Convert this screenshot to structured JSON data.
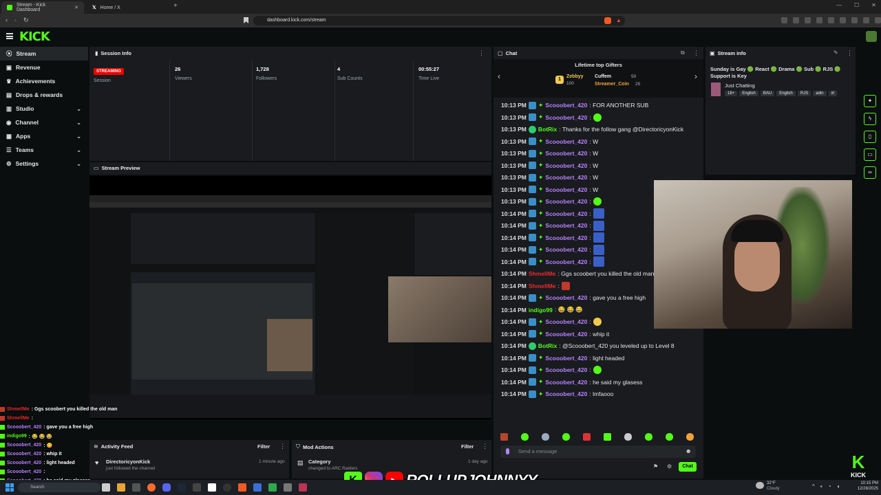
{
  "browser": {
    "tabs": [
      {
        "label": "Stream - Kick Dashboard",
        "active": true
      },
      {
        "label": "Home / X",
        "active": false
      }
    ],
    "url": "dashboard.kick.com/stream"
  },
  "logo": "KICK",
  "sidebar": {
    "items": [
      {
        "label": "Stream",
        "icon": "broadcast-icon",
        "active": true,
        "expandable": false
      },
      {
        "label": "Revenue",
        "icon": "wallet-icon",
        "expandable": false
      },
      {
        "label": "Achievements",
        "icon": "trophy-icon",
        "expandable": false
      },
      {
        "label": "Drops & rewards",
        "icon": "gift-icon",
        "expandable": false
      },
      {
        "label": "Studio",
        "icon": "studio-icon",
        "expandable": true
      },
      {
        "label": "Channel",
        "icon": "channel-icon",
        "expandable": true
      },
      {
        "label": "Apps",
        "icon": "apps-icon",
        "expandable": true
      },
      {
        "label": "Teams",
        "icon": "teams-icon",
        "expandable": true
      },
      {
        "label": "Settings",
        "icon": "gear-icon",
        "expandable": true
      }
    ]
  },
  "session": {
    "title": "Session Info",
    "badge": "STREAMING",
    "stats": [
      {
        "value": "",
        "label": "Session"
      },
      {
        "value": "26",
        "label": "Viewers"
      },
      {
        "value": "1,728",
        "label": "Followers"
      },
      {
        "value": "4",
        "label": "Sub Counts"
      },
      {
        "value": "00:55:27",
        "label": "Time Live"
      }
    ]
  },
  "preview": {
    "title": "Stream Preview"
  },
  "chat": {
    "title": "Chat",
    "gifters_title": "Lifetime top Gifters",
    "gifters": [
      {
        "name": "Zebbyy",
        "count": "100"
      },
      {
        "name": "Cuffem",
        "count": "50"
      },
      {
        "name": "Streamer_Coin",
        "count": "25"
      }
    ],
    "messages": [
      {
        "time": "10:13 PM",
        "user": "Scooobert_420",
        "text": ": FOR ANOTHER SUB",
        "color": "#b983ff"
      },
      {
        "time": "10:13 PM",
        "user": "Scooobert_420",
        "text": ":",
        "color": "#b983ff",
        "emote": "green"
      },
      {
        "time": "10:13 PM",
        "user": "BotRix",
        "text": ": Thanks for the follow gang @DirectoricyonKick",
        "color": "#53fc18"
      },
      {
        "time": "10:13 PM",
        "user": "Scooobert_420",
        "text": ": W",
        "color": "#b983ff"
      },
      {
        "time": "10:13 PM",
        "user": "Scooobert_420",
        "text": ": W",
        "color": "#b983ff"
      },
      {
        "time": "10:13 PM",
        "user": "Scooobert_420",
        "text": ": W",
        "color": "#b983ff"
      },
      {
        "time": "10:13 PM",
        "user": "Scooobert_420",
        "text": ": W",
        "color": "#b983ff"
      },
      {
        "time": "10:13 PM",
        "user": "Scooobert_420",
        "text": ": W",
        "color": "#b983ff"
      },
      {
        "time": "10:13 PM",
        "user": "Scooobert_420",
        "text": ":",
        "color": "#b983ff",
        "emote": "green"
      },
      {
        "time": "10:14 PM",
        "user": "Scooobert_420",
        "text": ":",
        "color": "#b983ff",
        "emote": "gang"
      },
      {
        "time": "10:14 PM",
        "user": "Scooobert_420",
        "text": ":",
        "color": "#b983ff",
        "emote": "gang"
      },
      {
        "time": "10:14 PM",
        "user": "Scooobert_420",
        "text": ":",
        "color": "#b983ff",
        "emote": "gang"
      },
      {
        "time": "10:14 PM",
        "user": "Scooobert_420",
        "text": ":",
        "color": "#b983ff",
        "emote": "gang"
      },
      {
        "time": "10:14 PM",
        "user": "Scooobert_420",
        "text": ":",
        "color": "#b983ff",
        "emote": "gang"
      },
      {
        "time": "10:14 PM",
        "user": "ShmellMe",
        "text": ": Ggs scoobert you killed the old man",
        "color": "#eb2b2b"
      },
      {
        "time": "10:14 PM",
        "user": "ShmellMe",
        "text": ":",
        "color": "#eb2b2b",
        "emote": "red"
      },
      {
        "time": "10:14 PM",
        "user": "Scooobert_420",
        "text": ": gave you a free high",
        "color": "#b983ff"
      },
      {
        "time": "10:14 PM",
        "user": "indigo99",
        "text": ": 😂 😂 😂",
        "color": "#53fc18"
      },
      {
        "time": "10:14 PM",
        "user": "Scooobert_420",
        "text": ":",
        "color": "#b983ff",
        "emote": "yellow"
      },
      {
        "time": "10:14 PM",
        "user": "Scooobert_420",
        "text": ": whip it",
        "color": "#b983ff"
      },
      {
        "time": "10:14 PM",
        "user": "BotRix",
        "text": ": @Scooobert_420 you leveled up to Level 8",
        "color": "#53fc18"
      },
      {
        "time": "10:14 PM",
        "user": "Scooobert_420",
        "text": ": light headed",
        "color": "#b983ff"
      },
      {
        "time": "10:14 PM",
        "user": "Scooobert_420",
        "text": ":",
        "color": "#b983ff",
        "emote": "green"
      },
      {
        "time": "10:14 PM",
        "user": "Scooobert_420",
        "text": ": he said my glasess",
        "color": "#b983ff"
      },
      {
        "time": "10:14 PM",
        "user": "Scooobert_420",
        "text": ": lmfaooo",
        "color": "#b983ff"
      }
    ],
    "input_placeholder": "Send a message",
    "send_label": "Chat"
  },
  "stream_info": {
    "title": "Stream info",
    "stream_title": "Sunday is Gay 🟢 React 🟢 Drama 🟢 Sub 🟢 RJS 🟢 Support is Key",
    "category": "Just Chatting",
    "tags": [
      "18+",
      "English",
      "BAU",
      "English",
      "RJS",
      "adin",
      "irl"
    ]
  },
  "activity": {
    "title": "Activity Feed",
    "filter": "Filter",
    "item_user": "DirectoricyonKick",
    "item_text": "just followed the channel",
    "item_time": "1 minute ago"
  },
  "mod": {
    "title": "Mod Actions",
    "filter": "Filter",
    "item_title": "Category",
    "item_text": "changed to ARC Raiders",
    "item_time": "1 day ago"
  },
  "overlay_chat": [
    {
      "user": "ShmellMe",
      "text": ": Ggs scoobert you killed the old man",
      "color": "#eb2b2b"
    },
    {
      "user": "ShmellMe",
      "text": ":",
      "color": "#eb2b2b"
    },
    {
      "user": "Scooobert_420",
      "text": ": gave you a free high",
      "color": "#b983ff"
    },
    {
      "user": "indigo99",
      "text": ": 😂 😂 😂",
      "color": "#53fc18"
    },
    {
      "user": "Scooobert_420",
      "text": ": 😋",
      "color": "#b983ff"
    },
    {
      "user": "Scooobert_420",
      "text": ": whip it",
      "color": "#b983ff"
    },
    {
      "user": "Scooobert_420",
      "text": ": light headed",
      "color": "#b983ff"
    },
    {
      "user": "Scooobert_420",
      "text": ":",
      "color": "#b983ff"
    },
    {
      "user": "Scooobert_420",
      "text": ": he said my glasess",
      "color": "#b983ff"
    },
    {
      "user": "Scooobert_420",
      "text": ": lmfaooo",
      "color": "#b983ff"
    }
  ],
  "handle_banner": "ROLLUPJOHNNYY",
  "taskbar": {
    "search": "Search",
    "weather_temp": "32°F",
    "weather_desc": "Cloudy",
    "time": "10:15 PM",
    "date": "12/28/2025"
  },
  "colors": {
    "kick_green": "#53fc18",
    "streaming_red": "#eb0400",
    "panel": "#191b1f"
  }
}
